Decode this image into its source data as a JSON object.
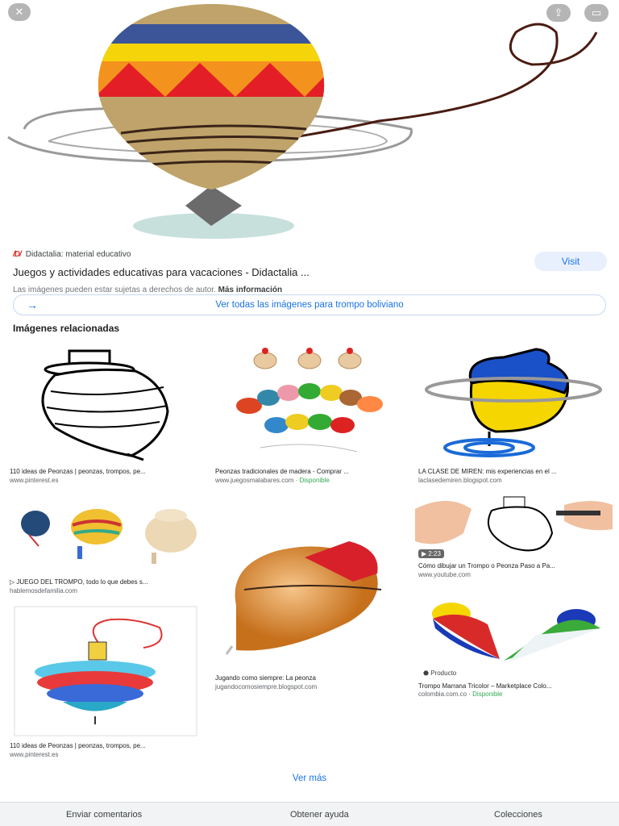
{
  "hero": {
    "close_icon": "close-icon",
    "share_icon": "share-icon",
    "collection_icon": "collection-icon"
  },
  "source": {
    "site_name": "Didactalia: material educativo",
    "favicon_text": "/D/",
    "page_title": "Juegos y actividades educativas para vacaciones - Didactalia ...",
    "rights_text": "Las imágenes pueden estar sujetas a derechos de autor.",
    "more_info": "Más información",
    "visit_label": "Visit"
  },
  "all_images_label": "Ver todas las imágenes para trompo boliviano",
  "related_heading": "Imágenes relacionadas",
  "results": [
    {
      "caption": "110 ideas de Peonzas | peonzas, trompos, pe...",
      "domain": "www.pinterest.es",
      "available": ""
    },
    {
      "caption": "Peonzas tradicionales de madera - Comprar ...",
      "domain": "www.juegosmalabares.com",
      "available": "Disponible"
    },
    {
      "caption": "LA CLASE DE MIREN: mis experiencias en el ...",
      "domain": "laclasedemiren.blogspot.com",
      "available": ""
    },
    {
      "caption": "JUEGO DEL TROMPO, todo lo que debes s...",
      "domain": "hablemosdefamilia.com",
      "available": ""
    },
    {
      "caption": "Jugando como siempre: La peonza",
      "domain": "jugandocomosiempre.blogspot.com",
      "available": ""
    },
    {
      "caption": "Cómo dibujar un Trompo o Peonza Paso a Pa...",
      "domain": "www.youtube.com",
      "available": "",
      "duration": "2:23"
    },
    {
      "caption": "110 ideas de Peonzas | peonzas, trompos, pe...",
      "domain": "www.pinterest.es",
      "available": ""
    },
    {
      "caption": "Trompo Marrana Tricolor – Marketplace Colo...",
      "domain": "colombia.com.co",
      "available": "Disponible",
      "tag": "Producto"
    }
  ],
  "ver_mas": "Ver más",
  "footer": {
    "feedback": "Enviar comentarios",
    "help": "Obtener ayuda",
    "collections": "Colecciones"
  }
}
